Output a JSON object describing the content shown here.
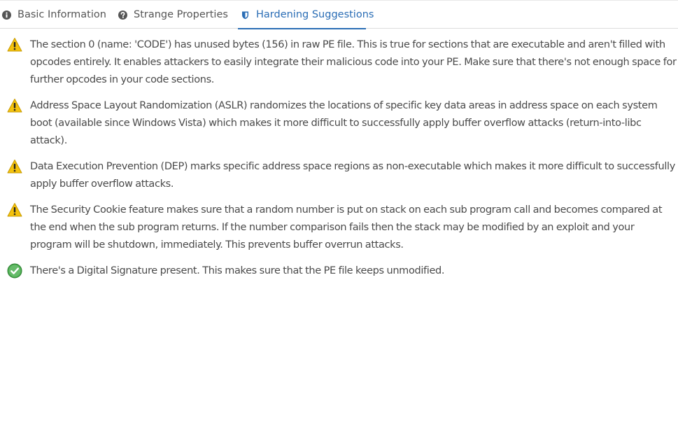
{
  "tabs": [
    {
      "label": "Basic Information",
      "icon": "info-circle-icon",
      "active": false
    },
    {
      "label": "Strange Properties",
      "icon": "question-circle-icon",
      "active": false
    },
    {
      "label": "Hardening Suggestions",
      "icon": "shield-icon",
      "active": true
    }
  ],
  "colors": {
    "accent": "#2a6db5",
    "warning": "#f4c20d",
    "success": "#4caf50"
  },
  "suggestions": [
    {
      "status": "warning",
      "icon": "warning-triangle-icon",
      "text": "The section 0 (name: 'CODE') has unused bytes (156) in raw PE file. This is true for sections that are executable and aren't filled with opcodes entirely. It enables attackers to easily integrate their malicious code into your PE. Make sure that there's not enough space for further opcodes in your code sections."
    },
    {
      "status": "warning",
      "icon": "warning-triangle-icon",
      "text": "Address Space Layout Randomization (ASLR) randomizes the locations of specific key data areas in address space on each system boot (available since Windows Vista) which makes it more difficult to successfully apply buffer overflow attacks (return-into-libc attack)."
    },
    {
      "status": "warning",
      "icon": "warning-triangle-icon",
      "text": "Data Execution Prevention (DEP) marks specific address space regions as non-executable which makes it more difficult to successfully apply buffer overflow attacks."
    },
    {
      "status": "warning",
      "icon": "warning-triangle-icon",
      "text": "The Security Cookie feature makes sure that a random number is put on stack on each sub program call and becomes compared at the end when the sub program returns. If the number comparison fails then the stack may be modified by an exploit and your program will be shutdown, immediately. This prevents buffer overrun attacks."
    },
    {
      "status": "ok",
      "icon": "check-circle-icon",
      "text": "There's a Digital Signature present. This makes sure that the PE file keeps unmodified."
    }
  ]
}
